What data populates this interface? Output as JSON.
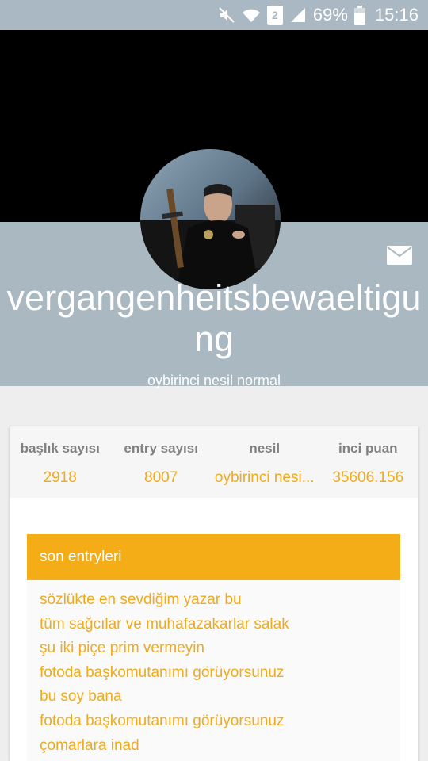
{
  "status_bar": {
    "icons": [
      "mute-icon",
      "wifi-icon",
      "sim-icon",
      "signal-icon",
      "battery-icon"
    ],
    "sim_label": "2",
    "battery_percent": "69%",
    "time": "15:16"
  },
  "profile": {
    "username": "vergangenheitsbewaeltigung",
    "generation": "oybirinci nesil normal"
  },
  "stats": [
    {
      "label": "başlık sayısı",
      "value": "2918"
    },
    {
      "label": "entry sayısı",
      "value": "8007"
    },
    {
      "label": "nesil",
      "value": "oybirinci nesi..."
    },
    {
      "label": "inci puan",
      "value": "35606.156"
    }
  ],
  "entries_section": {
    "title": "son entryleri",
    "items": [
      "sözlükte en sevdiğim yazar bu",
      "tüm sağcılar ve muhafazakarlar salak",
      "şu iki piçe prim vermeyin",
      "fotoda başkomutanımı görüyorsunuz",
      "bu soy bana",
      "fotoda başkomutanımı görüyorsunuz",
      "çomarlara inad"
    ]
  },
  "colors": {
    "accent": "#f4ac17",
    "band": "#a9b8c1",
    "link": "#f0ab1c"
  }
}
